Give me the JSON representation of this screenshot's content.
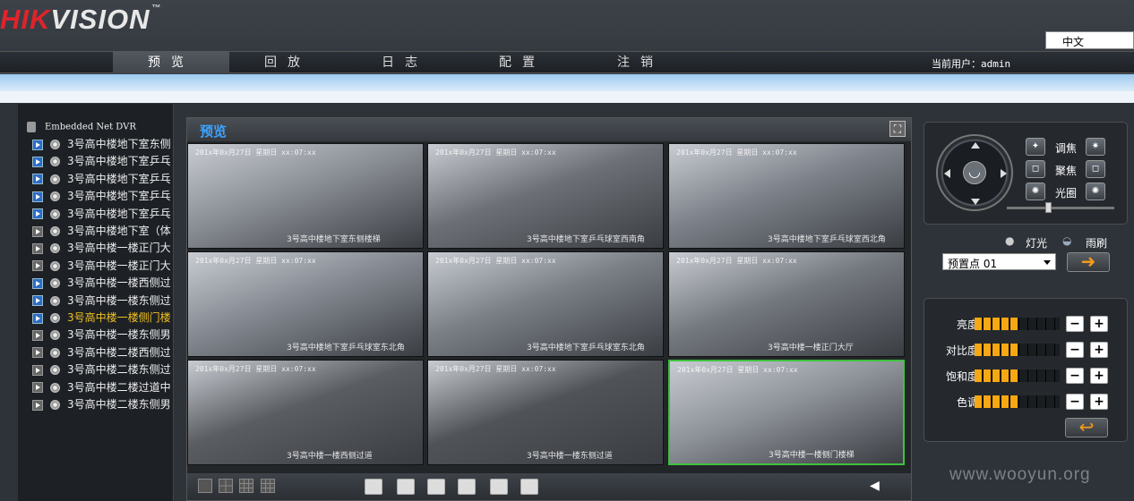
{
  "header": {
    "logo_hik": "HIK",
    "logo_vision": "VISION",
    "logo_tm": "™",
    "language": "中文"
  },
  "nav": {
    "items": [
      {
        "label": "预览"
      },
      {
        "label": "回放"
      },
      {
        "label": "日志"
      },
      {
        "label": "配置"
      },
      {
        "label": "注销"
      }
    ],
    "current_user_label": "当前用户：admin"
  },
  "tree": {
    "root": "Embedded Net DVR",
    "channels": [
      {
        "label": "3号高中楼地下室东侧",
        "state": "blue"
      },
      {
        "label": "3号高中楼地下室乒乓",
        "state": "blue"
      },
      {
        "label": "3号高中楼地下室乒乓",
        "state": "blue"
      },
      {
        "label": "3号高中楼地下室乒乓",
        "state": "blue"
      },
      {
        "label": "3号高中楼地下室乒乓",
        "state": "blue"
      },
      {
        "label": "3号高中楼地下室（体",
        "state": "grey"
      },
      {
        "label": "3号高中楼一楼正门大",
        "state": "grey"
      },
      {
        "label": "3号高中楼一楼正门大",
        "state": "grey"
      },
      {
        "label": "3号高中楼一楼西侧过",
        "state": "blue"
      },
      {
        "label": "3号高中楼一楼东侧过",
        "state": "blue"
      },
      {
        "label": "3号高中楼一楼侧门楼",
        "state": "blue",
        "highlight": true
      },
      {
        "label": "3号高中楼一楼东侧男",
        "state": "grey"
      },
      {
        "label": "3号高中楼二楼西侧过",
        "state": "grey"
      },
      {
        "label": "3号高中楼二楼东侧过",
        "state": "grey"
      },
      {
        "label": "3号高中楼二楼过道中",
        "state": "grey"
      },
      {
        "label": "3号高中楼二楼东侧男",
        "state": "grey"
      }
    ]
  },
  "viewer": {
    "title": "预览",
    "tiles": [
      {
        "osd": "201x年0x月27日  星期日  xx:07:xx",
        "caption": "3号高中楼地下室东侧楼梯",
        "bg": "#8a8e95"
      },
      {
        "osd": "201x年0x月27日  星期日  xx:07:xx",
        "caption": "3号高中楼地下室乒乓球室西南角",
        "bg": "#6d7076"
      },
      {
        "osd": "201x年0x月27日  星期日  xx:07:xx",
        "caption": "3号高中楼地下室乒乓球室西北角",
        "bg": "#7d828a"
      },
      {
        "osd": "201x年0x月27日  星期日  xx:07:xx",
        "caption": "3号高中楼地下室乒乓球室东北角",
        "bg": "#858a92"
      },
      {
        "osd": "201x年0x月27日  星期日  xx:07:xx",
        "caption": "3号高中楼地下室乒乓球室东北角",
        "bg": "#7a7f86"
      },
      {
        "osd": "201x年0x月27日  星期日  xx:07:xx",
        "caption": "3号高中楼一楼正门大厅",
        "bg": "#74787f"
      },
      {
        "osd": "201x年0x月27日  星期日  xx:07:xx",
        "caption": "3号高中楼一楼西侧过道",
        "bg": "#5a5d62"
      },
      {
        "osd": "201x年0x月27日  星期日  xx:07:xx",
        "caption": "3号高中楼一楼东侧过道",
        "bg": "#505357"
      },
      {
        "osd": "201x年0x月27日  星期日  xx:07:xx",
        "caption": "3号高中楼一楼侧门楼梯",
        "bg": "#8e9299",
        "selected": true
      }
    ]
  },
  "ptz": {
    "zoom_label": "调焦",
    "focus_label": "聚焦",
    "iris_label": "光圈",
    "light_label": "灯光",
    "wiper_label": "雨刷",
    "preset_value": "预置点 01",
    "speed_fraction": 0.38
  },
  "video_params": [
    {
      "label": "亮度",
      "level": 5,
      "max": 10
    },
    {
      "label": "对比度",
      "level": 5,
      "max": 10
    },
    {
      "label": "饱和度",
      "level": 5,
      "max": 10
    },
    {
      "label": "色调",
      "level": 5,
      "max": 10
    }
  ],
  "watermark": "www.wooyun.org",
  "colors": {
    "accent_blue": "#3da3ff",
    "highlight": "#f0c020",
    "level_fill": "#f5a814",
    "selected_border": "#3fc23f"
  }
}
